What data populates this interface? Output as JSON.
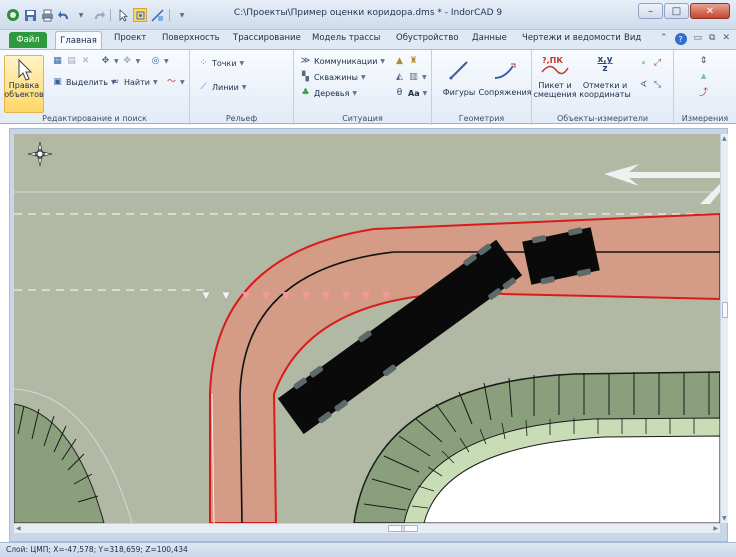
{
  "window": {
    "title": "C:\\Проекты\\Пример оценки коридора.dms * - IndorCAD 9",
    "controls": {
      "minimize": "–",
      "maximize": "□",
      "close": "✕"
    }
  },
  "quick_access": {
    "icons": [
      "app-logo-icon",
      "save-icon",
      "print-icon",
      "undo-icon",
      "redo-icon",
      "select-icon",
      "snap-icon",
      "customize-icon"
    ]
  },
  "tabs": {
    "file": "Файл",
    "home": "Главная",
    "project": "Проект",
    "surface": "Поверхность",
    "tracing": "Трассирование",
    "route_model": "Модель трассы",
    "arrangement": "Обустройство",
    "data": "Данные",
    "drawings": "Чертежи и ведомости",
    "view": "Вид"
  },
  "ribbon": {
    "groups": {
      "edit_search": "Редактирование и поиск",
      "relief": "Рельеф",
      "situation": "Ситуация",
      "geometry": "Геометрия",
      "measure_objects": "Объекты-измерители",
      "measurements": "Измерения"
    },
    "buttons": {
      "select_objects_line1": "Правка",
      "select_objects_line2": "объектов",
      "select": "Выделить",
      "find": "Найти",
      "points": "Точки",
      "lines": "Линии",
      "communications": "Коммуникации",
      "wells": "Скважины",
      "trees": "Деревья",
      "figures": "Фигуры",
      "connections": "Сопряжения",
      "picket_line1": "Пикет и",
      "picket_line2": "смещения",
      "marks_line1": "Отметки и",
      "marks_line2": "координаты",
      "text_style": "Aa",
      "coords_icon_label": "x,y",
      "coords_icon_sub": "z",
      "picket_icon_label": "?,ПК"
    }
  },
  "status": {
    "text": "Слой: ЦМП; X=-47,578; Y=318,659; Z=100,434"
  },
  "colors": {
    "road_fill": "#d49b86",
    "road_edge": "#d81c1c",
    "ground": "#b1b8a4",
    "grass": "#8aa07d",
    "vehicle": "#0a0a0a",
    "file_tab": "#2c9a3d"
  }
}
